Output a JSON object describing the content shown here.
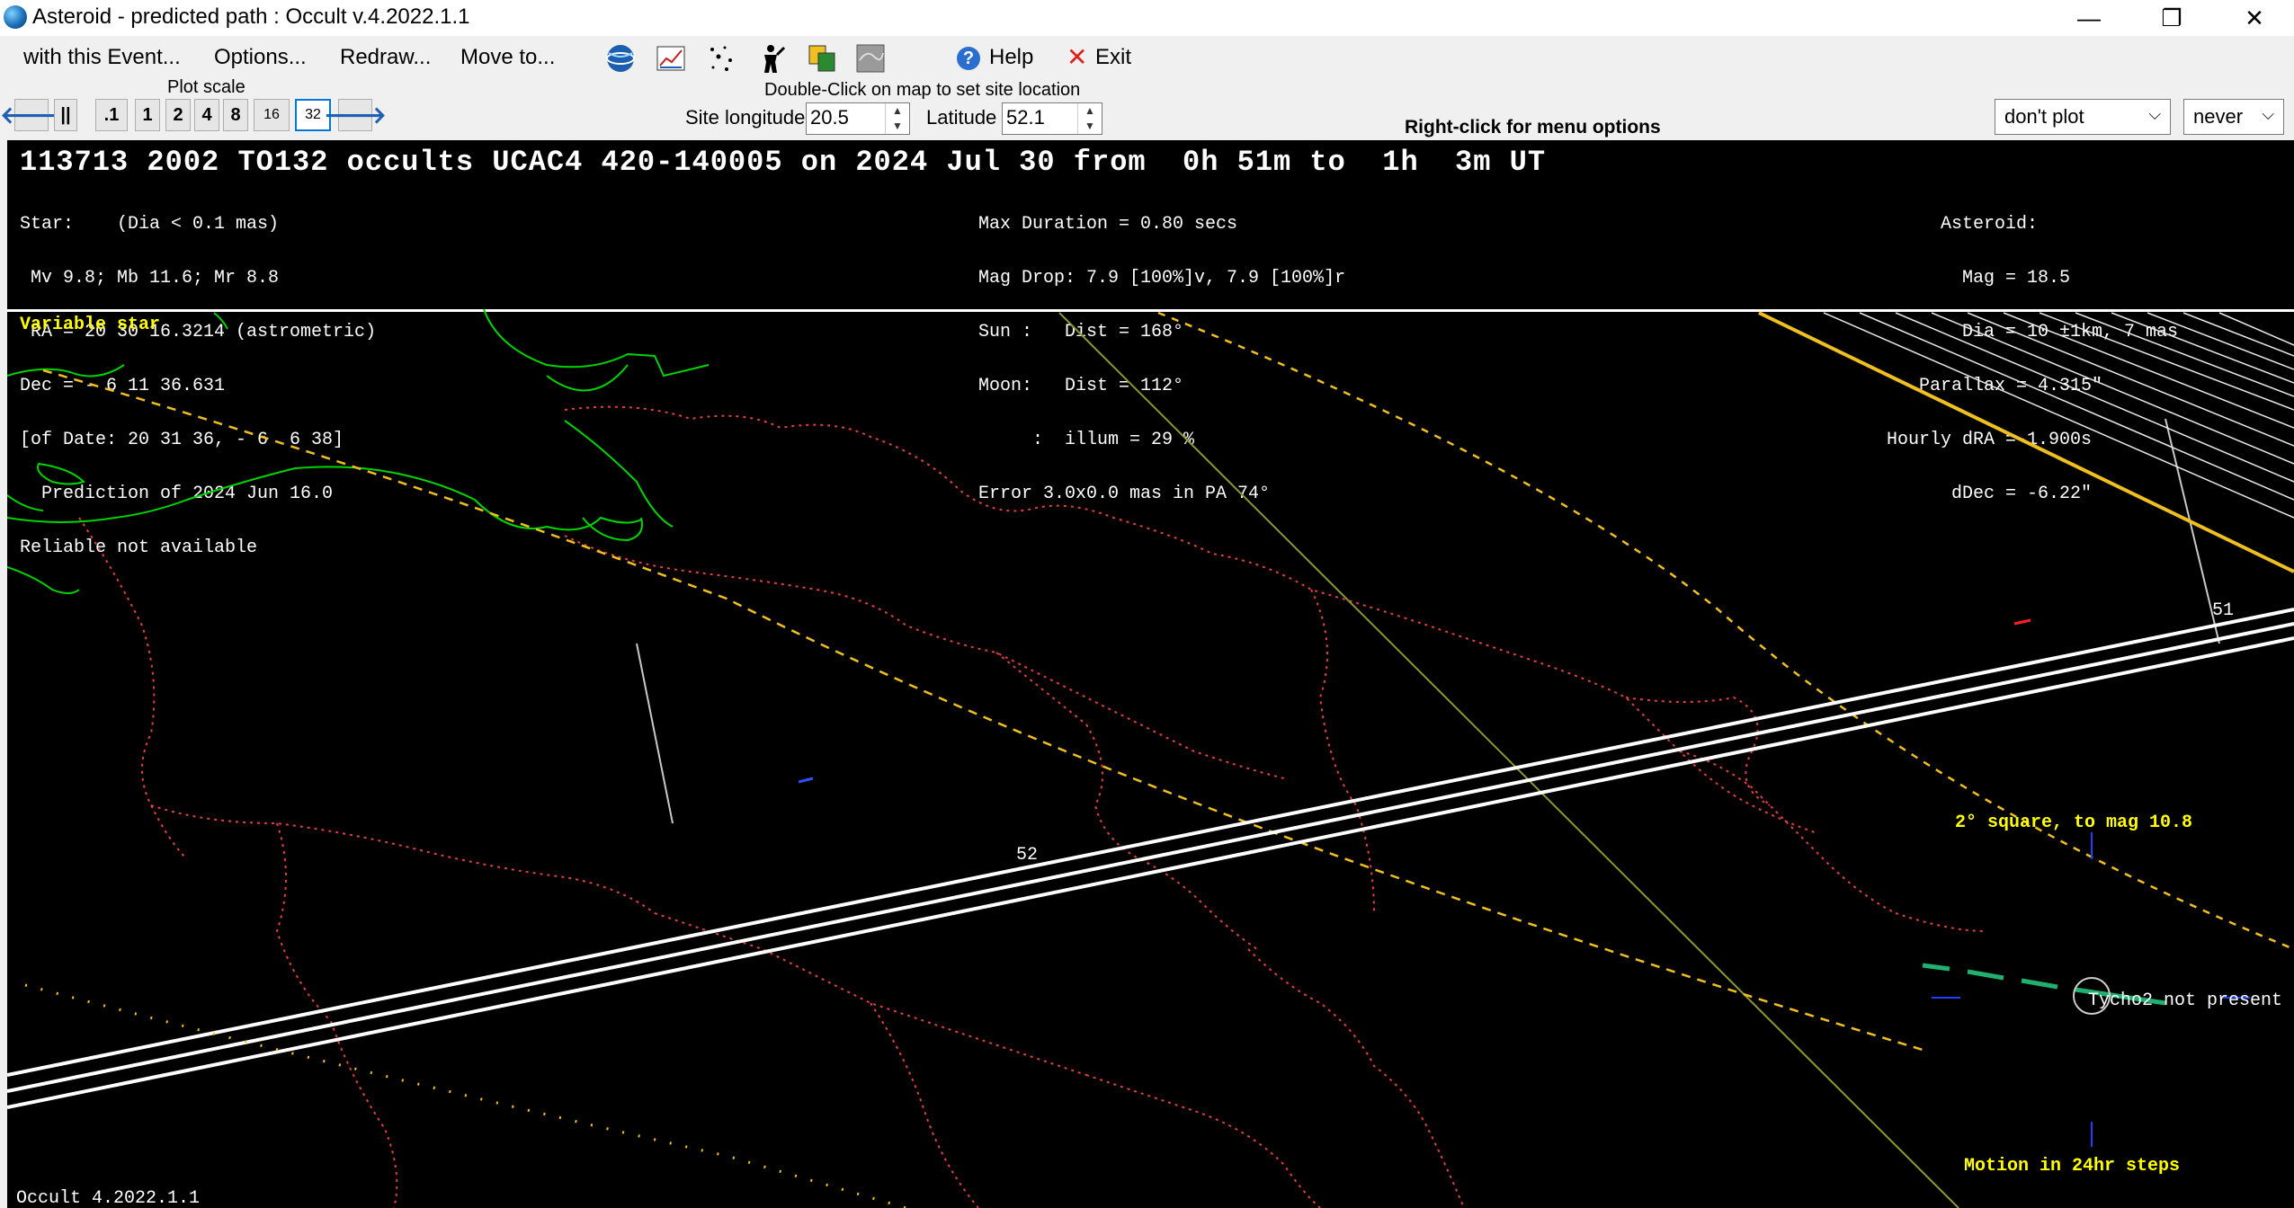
{
  "window": {
    "title": "Asteroid - predicted path : Occult v.4.2022.1.1",
    "controls": [
      "—",
      "❐",
      "✕"
    ]
  },
  "menu": {
    "items": [
      "with this Event...",
      "Options...",
      "Redraw...",
      "Move to..."
    ],
    "help": "Help",
    "exit": "Exit"
  },
  "toolbar_icons": [
    "globe-icon",
    "chart-icon",
    "star-field-icon",
    "person-icon",
    "copy-icon",
    "map-icon"
  ],
  "plot_scale": {
    "caption": "Plot scale",
    "buttons": [
      "||",
      ".1",
      "1",
      "2",
      "4",
      "8",
      "16",
      "32"
    ],
    "selected": "32"
  },
  "site": {
    "hint": "Double-Click on map to set site location",
    "longitude_label": "Site longitude",
    "longitude_value": "20.5",
    "latitude_label": "Latitude",
    "latitude_value": "52.1"
  },
  "right_click_hint": "Right-click for menu options",
  "selects": {
    "plot_option": "don't plot",
    "never_option": "never"
  },
  "event": {
    "title": "113713 2002 TO132 occults UCAC4 420-140005 on 2024 Jul 30 from  0h 51m to  1h  3m UT",
    "star_lines": [
      "Star:    (Dia < 0.1 mas)",
      " Mv 9.8; Mb 11.6; Mr 8.8",
      " RA = 20 30 16.3214 (astrometric)",
      "Dec = - 6 11 36.631",
      "[of Date: 20 31 36, - 6  6 38]",
      "  Prediction of 2024 Jun 16.0",
      "Reliable not available"
    ],
    "circumstance_lines": [
      "Max Duration = 0.80 secs",
      "Mag Drop: 7.9 [100%]v, 7.9 [100%]r",
      "Sun :   Dist = 168°",
      "Moon:   Dist = 112°",
      "     :  illum = 29 %",
      "Error 3.0x0.0 mas in PA 74°"
    ],
    "asteroid_lines": [
      "     Asteroid:",
      "       Mag = 18.5",
      "       Dia = 10 ±1km, 7 mas",
      "   Parallax = 4.315\"",
      "Hourly dRA =-1.900s",
      "      dDec = -6.22\""
    ]
  },
  "map": {
    "variable_star": "Variable star",
    "latitude_labels": [
      "52",
      "51"
    ],
    "square_label": "2° square, to mag 10.8",
    "tycho_label": "Tycho2 not present",
    "motion_label": "Motion in 24hr steps",
    "footer": "Occult 4.2022.1.1",
    "colors": {
      "coast": "#00d400",
      "border": "#e04040",
      "path": "#ffffff",
      "dotted_path": "#f0c020",
      "label": "#ffff00",
      "olive_line": "#8a9a30",
      "motion_dash": "#20b070"
    }
  }
}
